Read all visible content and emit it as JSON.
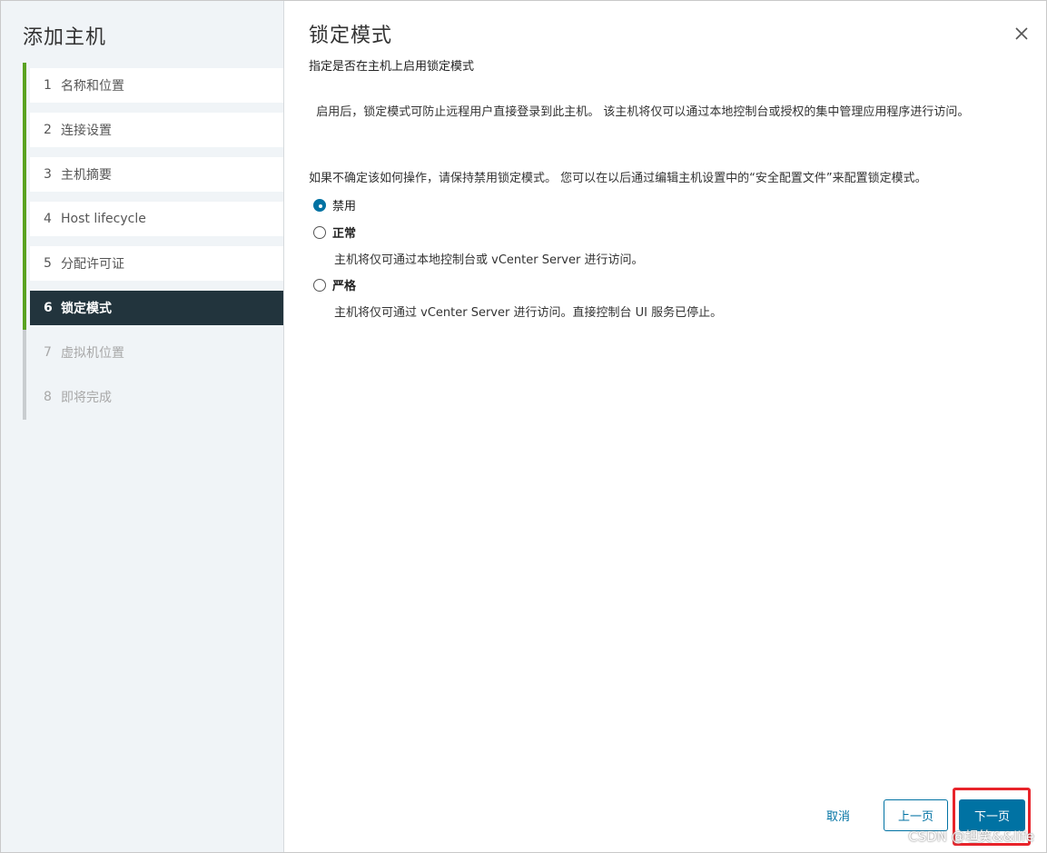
{
  "sidebar": {
    "title": "添加主机",
    "steps": [
      {
        "num": "1",
        "label": "名称和位置",
        "state": "done"
      },
      {
        "num": "2",
        "label": "连接设置",
        "state": "done"
      },
      {
        "num": "3",
        "label": "主机摘要",
        "state": "done"
      },
      {
        "num": "4",
        "label": "Host lifecycle",
        "state": "done"
      },
      {
        "num": "5",
        "label": "分配许可证",
        "state": "done"
      },
      {
        "num": "6",
        "label": "锁定模式",
        "state": "current"
      },
      {
        "num": "7",
        "label": "虚拟机位置",
        "state": "pending"
      },
      {
        "num": "8",
        "label": "即将完成",
        "state": "pending"
      }
    ]
  },
  "main": {
    "title": "锁定模式",
    "subtitle": "指定是否在主机上启用锁定模式",
    "description": "启用后，锁定模式可防止远程用户直接登录到此主机。 该主机将仅可以通过本地控制台或授权的集中管理应用程序进行访问。",
    "note": "如果不确定该如何操作，请保持禁用锁定模式。 您可以在以后通过编辑主机设置中的“安全配置文件”来配置锁定模式。",
    "options": [
      {
        "label": "禁用",
        "checked": true,
        "bold": false,
        "desc": ""
      },
      {
        "label": "正常",
        "checked": false,
        "bold": true,
        "desc": "主机将仅可通过本地控制台或 vCenter Server 进行访问。"
      },
      {
        "label": "严格",
        "checked": false,
        "bold": true,
        "desc": "主机将仅可通过 vCenter Server 进行访问。直接控制台 UI 服务已停止。"
      }
    ]
  },
  "footer": {
    "cancel_label": "取消",
    "back_label": "上一页",
    "next_label": "下一页"
  },
  "icons": {
    "close": "close-icon"
  },
  "colors": {
    "accent": "#0072a3",
    "step_done": "#5aa220",
    "step_current_bg": "#22343d",
    "highlight": "#e8232a"
  },
  "watermark": "CSDN @坦笑&&life"
}
